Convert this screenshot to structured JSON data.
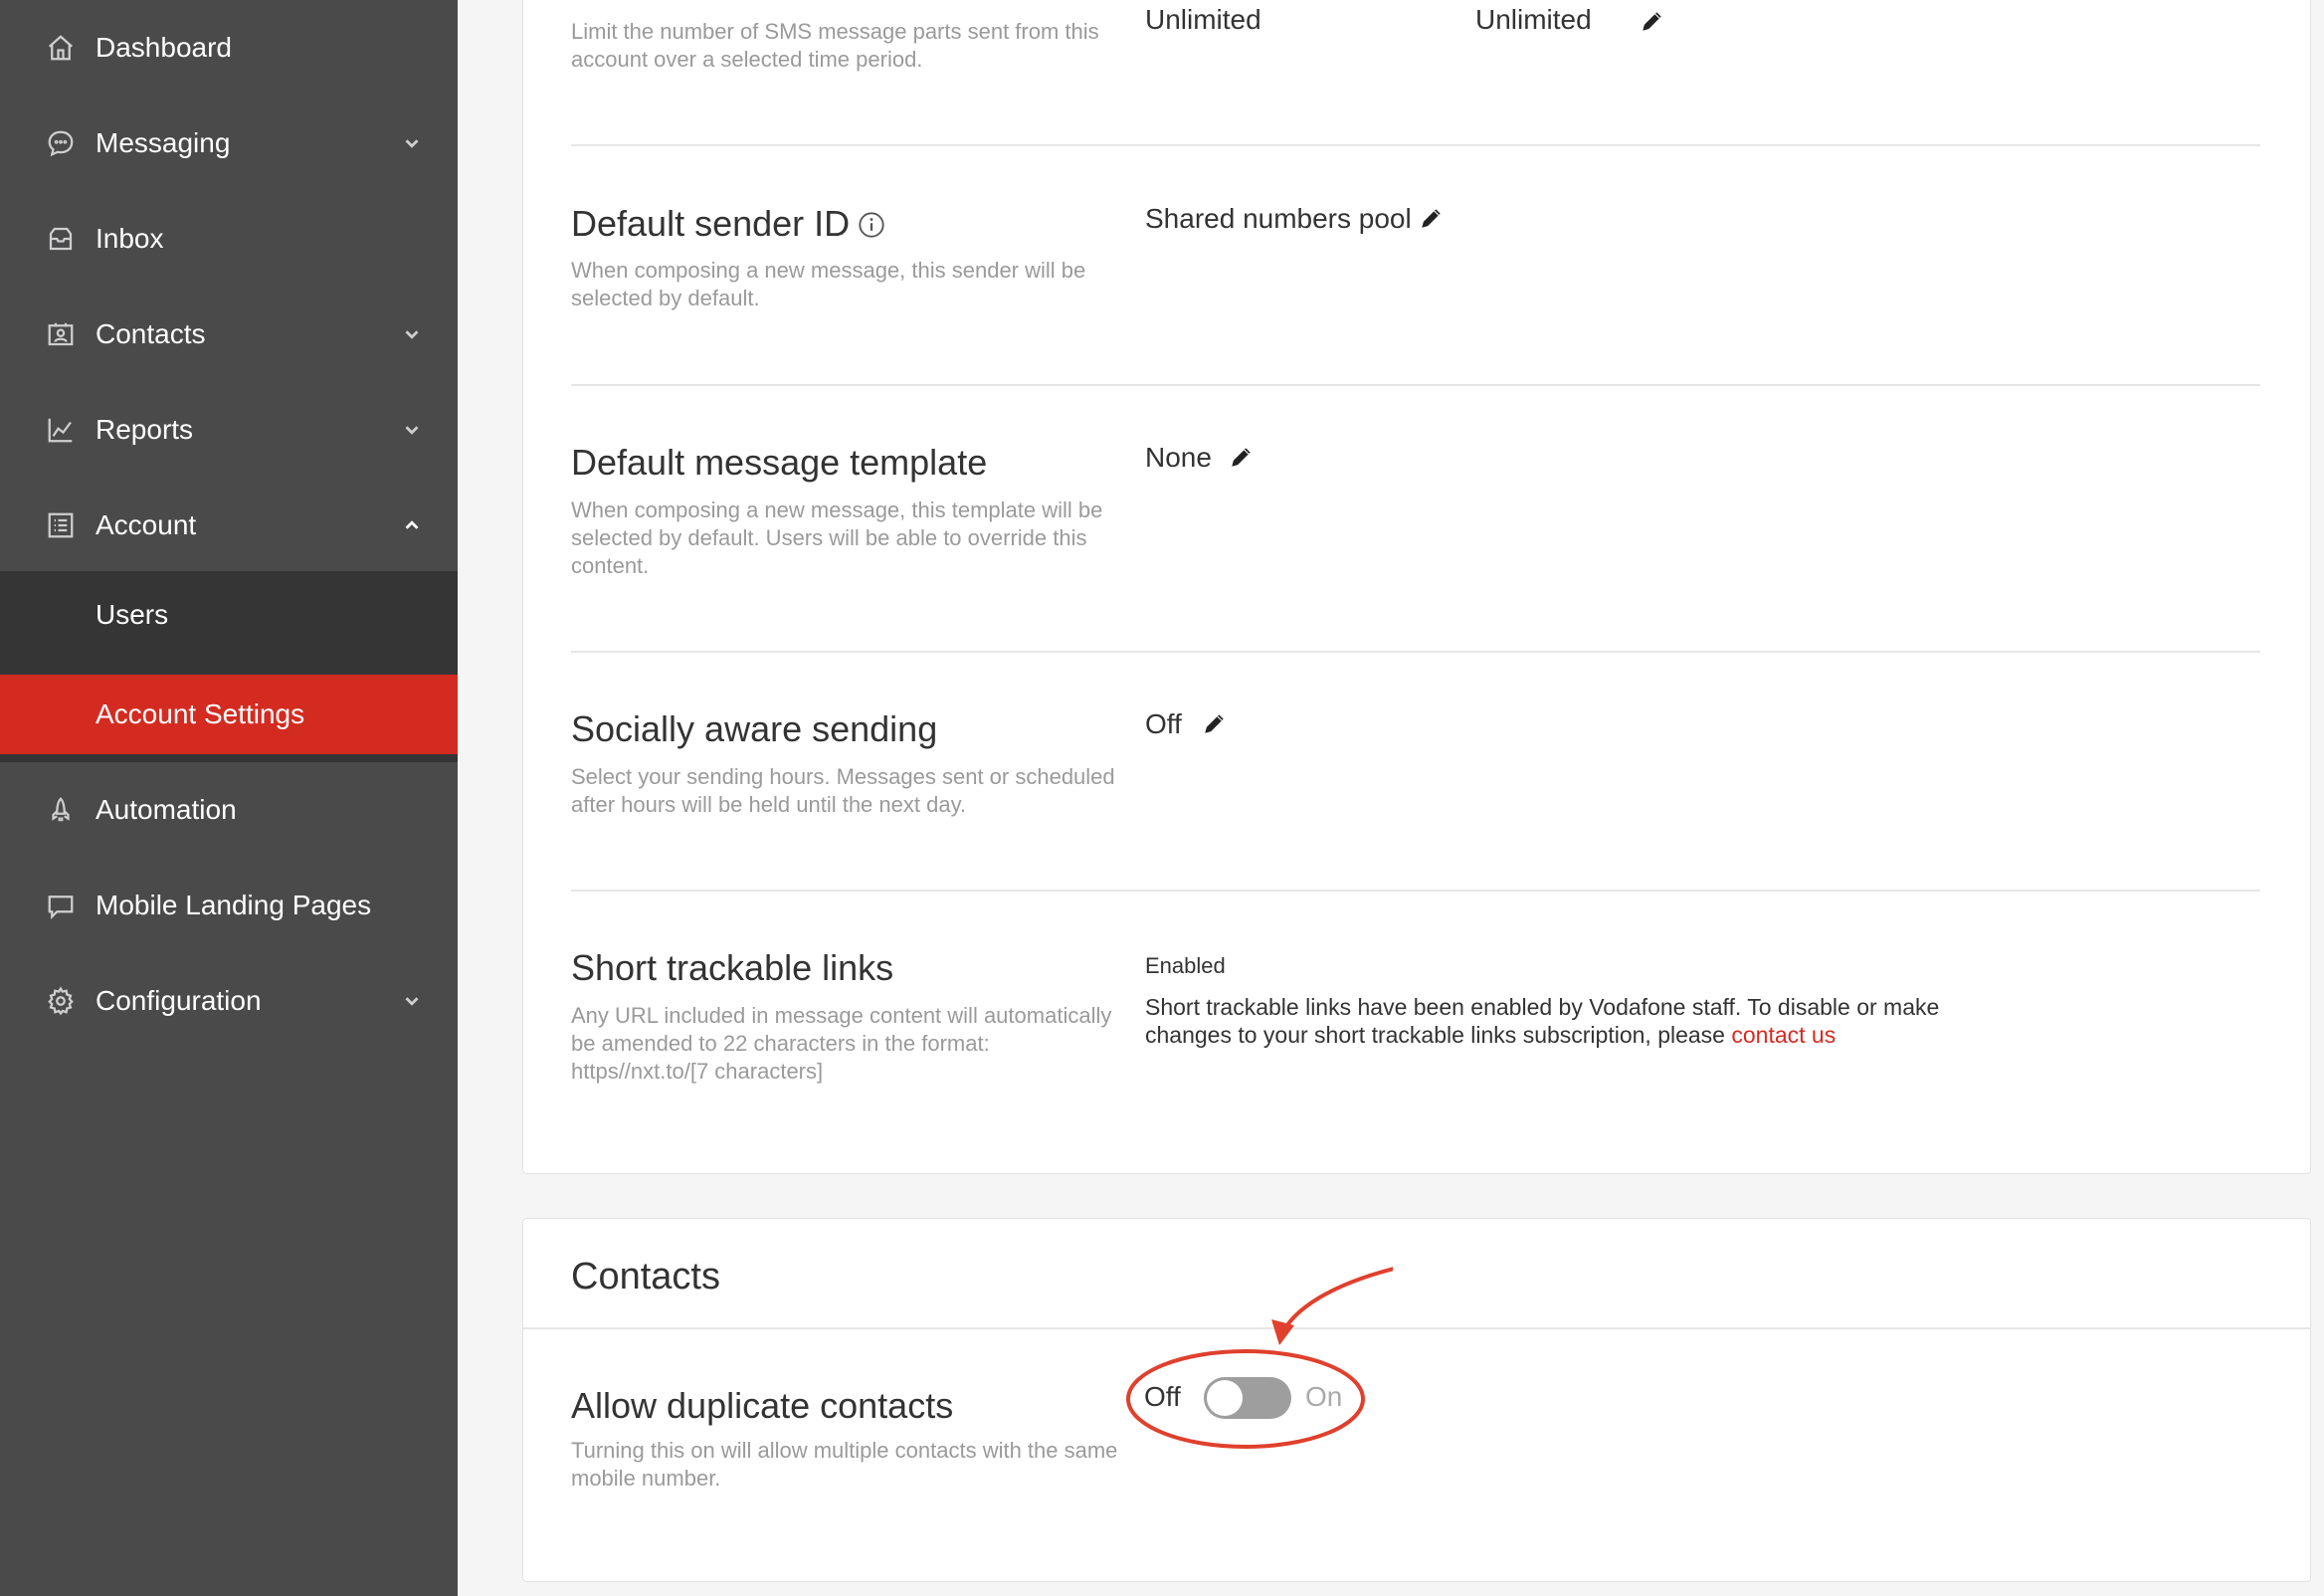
{
  "sidebar": {
    "items": [
      {
        "label": "Dashboard",
        "icon": "home-icon"
      },
      {
        "label": "Messaging",
        "icon": "chat-bubble-icon"
      },
      {
        "label": "Inbox",
        "icon": "inbox-icon"
      },
      {
        "label": "Contacts",
        "icon": "contact-card-icon"
      },
      {
        "label": "Reports",
        "icon": "line-chart-icon"
      },
      {
        "label": "Account",
        "icon": "list-icon"
      },
      {
        "label": "Automation",
        "icon": "rocket-icon"
      },
      {
        "label": "Mobile Landing Pages",
        "icon": "mobile-page-icon"
      },
      {
        "label": "Configuration",
        "icon": "gear-icon"
      }
    ],
    "sub_items": [
      {
        "label": "Users"
      },
      {
        "label": "Account Settings"
      }
    ]
  },
  "settings": {
    "sms_limit": {
      "desc": "Limit the number of SMS message parts sent from this account over a selected time period.",
      "value1": "Unlimited",
      "value2": "Unlimited"
    },
    "sender_id": {
      "title": "Default sender ID",
      "desc": "When composing a new message, this sender will be selected by default.",
      "value": "Shared numbers pool"
    },
    "message_template": {
      "title": "Default message template",
      "desc": "When composing a new message, this template will be selected by default. Users will be able to override this content.",
      "value": "None"
    },
    "socially_aware": {
      "title": "Socially aware sending",
      "desc": "Select your sending hours. Messages sent or scheduled after hours will be held until the next day.",
      "value": "Off"
    },
    "short_links": {
      "title": "Short trackable links",
      "desc": "Any URL included in message content will automatically be amended to 22 characters in the format: https//nxt.to/[7 characters]",
      "status": "Enabled",
      "note": "Short trackable links have been enabled by Vodafone staff. To disable or make changes to your short trackable links subscription, please",
      "link": "contact us"
    }
  },
  "contacts_section": {
    "title": "Contacts",
    "duplicate": {
      "title": "Allow duplicate contacts",
      "desc": "Turning this on will allow multiple contacts with the same mobile number.",
      "off_label": "Off",
      "on_label": "On",
      "state": "off"
    }
  },
  "colors": {
    "sidebar_bg": "#4a4a4b",
    "submenu_bg": "#353535",
    "accent": "#d42b21",
    "annotation": "#e0402d"
  }
}
